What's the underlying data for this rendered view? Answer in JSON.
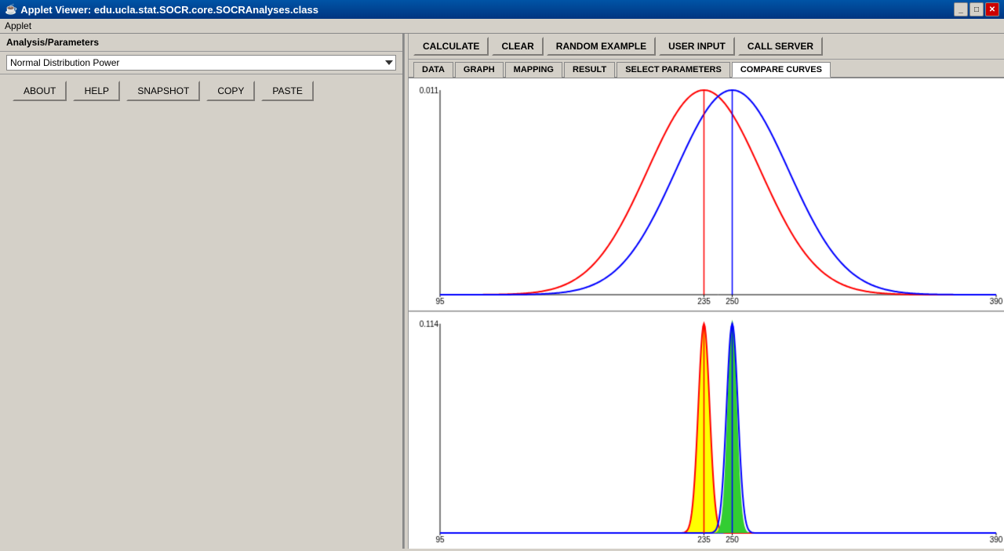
{
  "titleBar": {
    "icon": "★",
    "title": "Applet Viewer: edu.ucla.stat.SOCR.core.SOCRAnalyses.class",
    "controls": {
      "minimize": "_",
      "maximize": "□",
      "close": "✕"
    }
  },
  "menuBar": {
    "item": "Applet"
  },
  "leftPanel": {
    "header": "Analysis/Parameters",
    "dropdown": {
      "selected": "Normal Distribution Power",
      "options": [
        "Normal Distribution Power"
      ]
    },
    "buttons": [
      {
        "label": "ABOUT",
        "name": "about-button"
      },
      {
        "label": "HELP",
        "name": "help-button"
      },
      {
        "label": "SNAPSHOT",
        "name": "snapshot-button"
      },
      {
        "label": "COPY",
        "name": "copy-button"
      },
      {
        "label": "PASTE",
        "name": "paste-button"
      }
    ]
  },
  "toolbar": {
    "buttons": [
      {
        "label": "CALCULATE",
        "name": "calculate-button"
      },
      {
        "label": "CLEAR",
        "name": "clear-button"
      },
      {
        "label": "RANDOM EXAMPLE",
        "name": "random-example-button"
      },
      {
        "label": "USER INPUT",
        "name": "user-input-button"
      },
      {
        "label": "CALL SERVER",
        "name": "call-server-button"
      }
    ]
  },
  "tabs": [
    {
      "label": "DATA",
      "name": "tab-data",
      "active": false
    },
    {
      "label": "GRAPH",
      "name": "tab-graph",
      "active": false
    },
    {
      "label": "MAPPING",
      "name": "tab-mapping",
      "active": false
    },
    {
      "label": "RESULT",
      "name": "tab-result",
      "active": false
    },
    {
      "label": "SELECT PARAMETERS",
      "name": "tab-select-parameters",
      "active": false
    },
    {
      "label": "COMPARE CURVES",
      "name": "tab-compare-curves",
      "active": true
    }
  ],
  "charts": {
    "topChart": {
      "yAxisLabel": "0.011",
      "xMin": 95,
      "x235": 235,
      "x250": 250,
      "xMax": 390
    },
    "bottomChart": {
      "yAxisLabel": "0.114",
      "xMin": 95,
      "x235": 235,
      "x250": 250,
      "xMax": 390
    }
  }
}
